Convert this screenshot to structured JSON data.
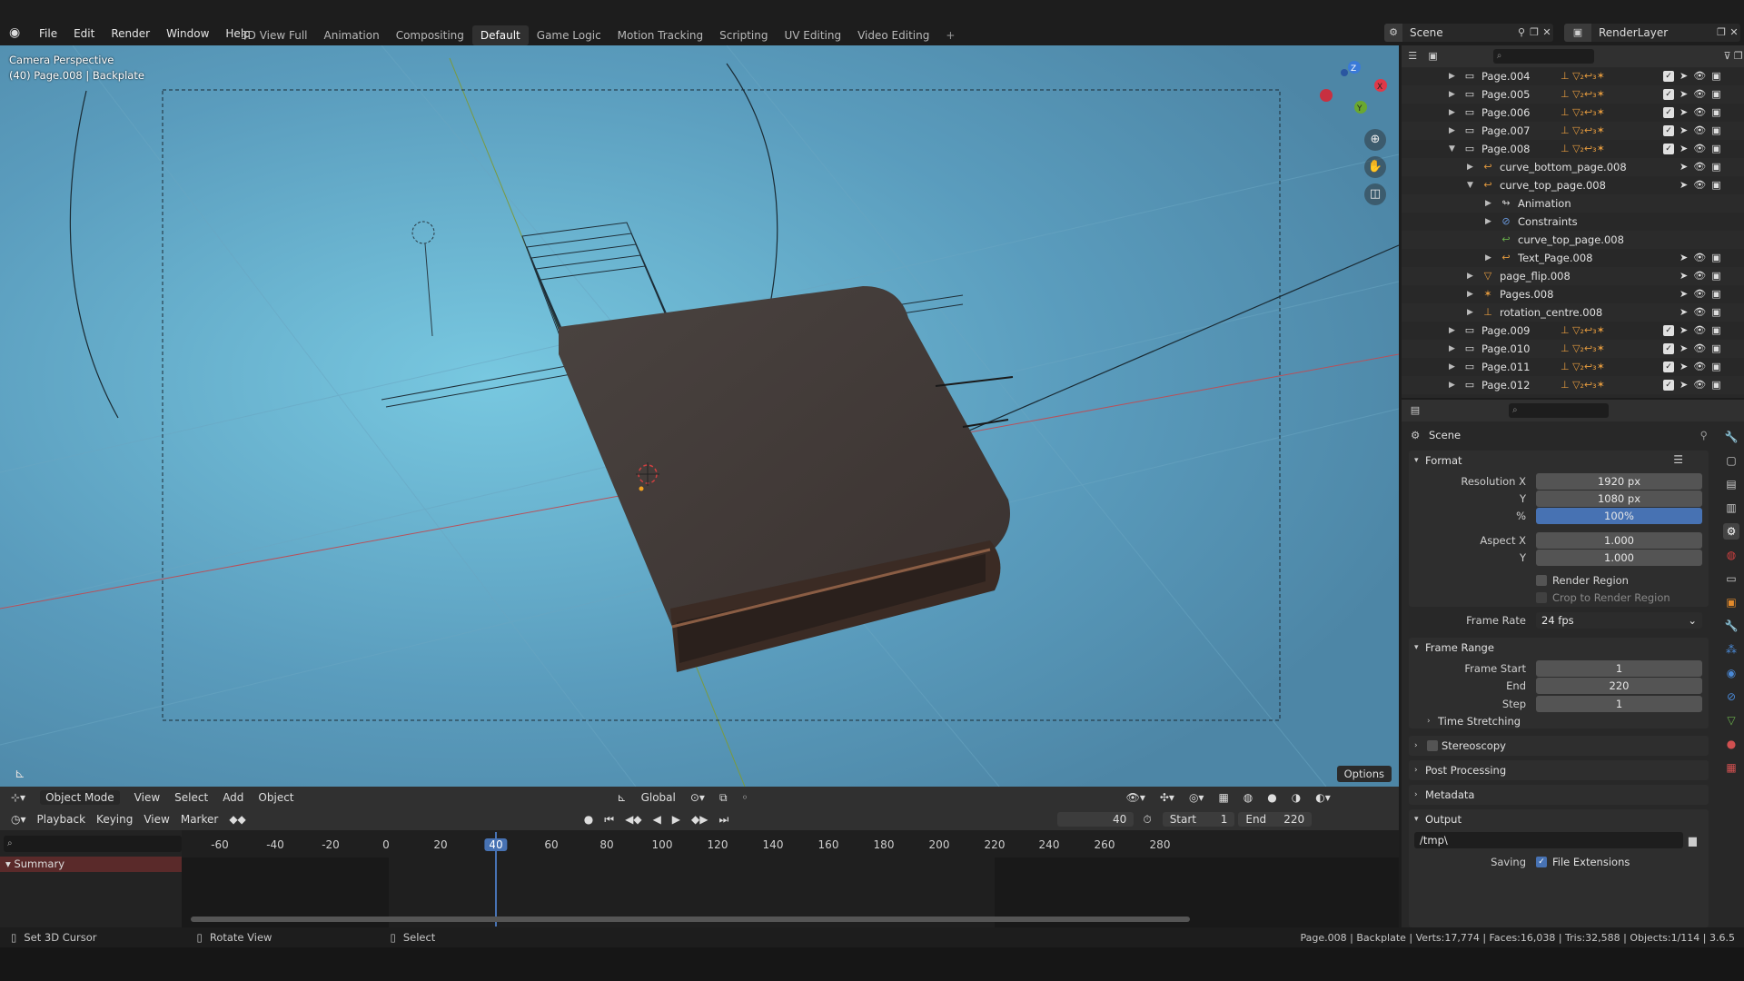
{
  "topbar": {
    "menu": [
      "File",
      "Edit",
      "Render",
      "Window",
      "Help"
    ],
    "workspaces": [
      "3D View Full",
      "Animation",
      "Compositing",
      "Default",
      "Game Logic",
      "Motion Tracking",
      "Scripting",
      "UV Editing",
      "Video Editing"
    ],
    "active_workspace": "Default",
    "add_workspace": "+",
    "scene": "Scene",
    "render_layer": "RenderLayer"
  },
  "viewport": {
    "line1": "Camera Perspective",
    "line2": "(40) Page.008 | Backplate",
    "options": "Options",
    "gizmo_x": "X",
    "gizmo_y": "Y",
    "gizmo_z": "Z",
    "bg_color": "#5a98b8"
  },
  "header3d": {
    "mode": "Object Mode",
    "menus": [
      "View",
      "Select",
      "Add",
      "Object"
    ],
    "orientation": "Global"
  },
  "timeline": {
    "playback": "Playback",
    "keying": "Keying",
    "menus": [
      "View",
      "Marker"
    ],
    "current_frame": "40",
    "start_label": "Start",
    "start": "1",
    "end_label": "End",
    "end": "220",
    "ruler": [
      "-60",
      "-40",
      "-20",
      "0",
      "20",
      "40",
      "60",
      "80",
      "100",
      "120",
      "140",
      "160",
      "180",
      "200",
      "220",
      "240",
      "260",
      "280"
    ],
    "summary": "Summary"
  },
  "outliner": {
    "rows": [
      {
        "name": "Page.004",
        "depth": 0,
        "expanded": false,
        "kind": "collection"
      },
      {
        "name": "Page.005",
        "depth": 0,
        "expanded": false,
        "kind": "collection"
      },
      {
        "name": "Page.006",
        "depth": 0,
        "expanded": false,
        "kind": "collection"
      },
      {
        "name": "Page.007",
        "depth": 0,
        "expanded": false,
        "kind": "collection"
      },
      {
        "name": "Page.008",
        "depth": 0,
        "expanded": true,
        "kind": "collection"
      },
      {
        "name": "curve_bottom_page.008",
        "depth": 1,
        "expanded": false,
        "kind": "curve"
      },
      {
        "name": "curve_top_page.008",
        "depth": 1,
        "expanded": true,
        "kind": "curve"
      },
      {
        "name": "Animation",
        "depth": 2,
        "expanded": false,
        "kind": "anim"
      },
      {
        "name": "Constraints",
        "depth": 2,
        "expanded": false,
        "kind": "constraint"
      },
      {
        "name": "curve_top_page.008",
        "depth": 2,
        "expanded": null,
        "kind": "curvedata"
      },
      {
        "name": "Text_Page.008",
        "depth": 2,
        "expanded": false,
        "kind": "curve"
      },
      {
        "name": "page_flip.008",
        "depth": 1,
        "expanded": false,
        "kind": "mesh"
      },
      {
        "name": "Pages.008",
        "depth": 1,
        "expanded": false,
        "kind": "armature"
      },
      {
        "name": "rotation_centre.008",
        "depth": 1,
        "expanded": false,
        "kind": "empty"
      },
      {
        "name": "Page.009",
        "depth": 0,
        "expanded": false,
        "kind": "collection"
      },
      {
        "name": "Page.010",
        "depth": 0,
        "expanded": false,
        "kind": "collection"
      },
      {
        "name": "Page.011",
        "depth": 0,
        "expanded": false,
        "kind": "collection"
      },
      {
        "name": "Page.012",
        "depth": 0,
        "expanded": false,
        "kind": "collection"
      }
    ]
  },
  "properties": {
    "context": "Scene",
    "format_title": "Format",
    "res_x_label": "Resolution X",
    "res_x": "1920 px",
    "res_y_label": "Y",
    "res_y": "1080 px",
    "res_pct_label": "%",
    "res_pct": "100%",
    "aspect_x_label": "Aspect X",
    "aspect_x": "1.000",
    "aspect_y_label": "Y",
    "aspect_y": "1.000",
    "render_region": "Render Region",
    "crop_region": "Crop to Render Region",
    "frame_rate_label": "Frame Rate",
    "frame_rate": "24 fps",
    "frame_range_title": "Frame Range",
    "frame_start_label": "Frame Start",
    "frame_start": "1",
    "end_label": "End",
    "end": "220",
    "step_label": "Step",
    "step": "1",
    "time_stretching": "Time Stretching",
    "stereoscopy": "Stereoscopy",
    "post_processing": "Post Processing",
    "metadata": "Metadata",
    "output_title": "Output",
    "output_path": "/tmp\\",
    "saving_label": "Saving",
    "file_extensions": "File Extensions"
  },
  "status": {
    "left1": "Set 3D Cursor",
    "left2": "Rotate View",
    "left3": "Select",
    "right": "Page.008 | Backplate | Verts:17,774 | Faces:16,038 | Tris:32,588 | Objects:1/114 | 3.6.5"
  }
}
